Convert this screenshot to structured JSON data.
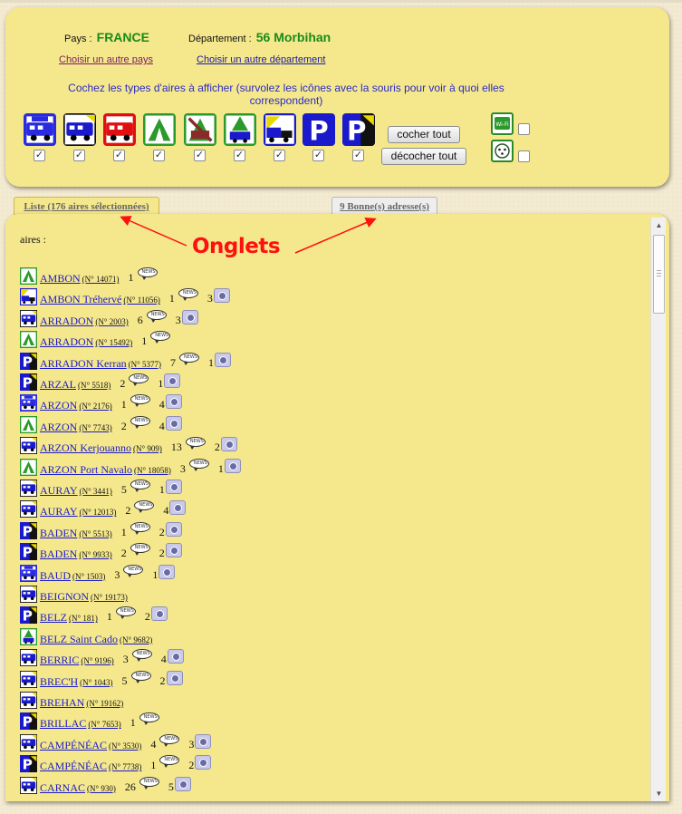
{
  "selection": {
    "country_label": "Pays :",
    "country_value": "FRANCE",
    "department_label": "Département :",
    "department_value": "56 Morbihan",
    "change_country_link": "Choisir un autre pays",
    "change_department_link": "Choisir un autre département",
    "instructions": "Cochez les types d'aires à afficher (survolez les icônes avec la souris pour voir à quoi elles correspondent)"
  },
  "type_filters": [
    {
      "icon": "motorhome-service-icon",
      "color": "#2a2ae0",
      "checked": true
    },
    {
      "icon": "motorhome-night-icon",
      "color": "#1a1acc",
      "checked": true
    },
    {
      "icon": "motorhome-paid-icon",
      "color": "#e01010",
      "checked": true
    },
    {
      "icon": "camping-icon",
      "color": "#2a9a2a",
      "checked": true
    },
    {
      "icon": "camping-closed-icon",
      "color": "#2a9a2a",
      "checked": true
    },
    {
      "icon": "camping-motorhome-icon",
      "color": "#2a9a2a",
      "checked": true
    },
    {
      "icon": "truck-night-icon",
      "color": "#1a1acc",
      "checked": true
    },
    {
      "icon": "parking-icon",
      "color": "#1a1acc",
      "checked": true
    },
    {
      "icon": "parking-night-icon",
      "color": "#1a1acc",
      "checked": true
    }
  ],
  "extra_filters": [
    {
      "icon": "wifi-icon",
      "label": "Wi-Fi",
      "checked": false
    },
    {
      "icon": "electric-plug-icon",
      "checked": false
    }
  ],
  "buttons": {
    "check_all": "cocher tout",
    "uncheck_all": "décocher tout"
  },
  "tabs": {
    "list": "Liste (176 aires sélectionnées)",
    "good_addresses": "9 Bonne(s) adresse(s)"
  },
  "annotation": "Onglets",
  "list": {
    "header": "aires :",
    "bubble_text": "NEWS",
    "rows": [
      {
        "icon": "camping-icon",
        "name": "AMBON",
        "num": "(N° 14071)",
        "comments": "1",
        "photos": ""
      },
      {
        "icon": "truck-night-icon",
        "name": "AMBON Tréhervé",
        "num": "(N° 11056)",
        "comments": "1",
        "photos": "3"
      },
      {
        "icon": "motorhome-night-icon",
        "name": "ARRADON",
        "num": "(N° 2003)",
        "comments": "6",
        "photos": "3"
      },
      {
        "icon": "camping-icon",
        "name": "ARRADON",
        "num": "(N° 15492)",
        "comments": "1",
        "photos": ""
      },
      {
        "icon": "parking-night-icon",
        "name": "ARRADON Kerran",
        "num": "(N° 5377)",
        "comments": "7",
        "photos": "1"
      },
      {
        "icon": "parking-night-icon",
        "name": "ARZAL",
        "num": "(N° 5518)",
        "comments": "2",
        "photos": "1"
      },
      {
        "icon": "motorhome-service-icon",
        "name": "ARZON",
        "num": "(N° 2176)",
        "comments": "1",
        "photos": "4"
      },
      {
        "icon": "camping-icon",
        "name": "ARZON",
        "num": "(N° 7743)",
        "comments": "2",
        "photos": "4"
      },
      {
        "icon": "motorhome-night-icon",
        "name": "ARZON Kerjouanno",
        "num": "(N° 909)",
        "comments": "13",
        "photos": "2"
      },
      {
        "icon": "camping-icon",
        "name": "ARZON Port Navalo",
        "num": "(N° 18058)",
        "comments": "3",
        "photos": "1"
      },
      {
        "icon": "motorhome-night-icon",
        "name": "AURAY",
        "num": "(N° 3441)",
        "comments": "5",
        "photos": "1"
      },
      {
        "icon": "motorhome-night-icon",
        "name": "AURAY",
        "num": "(N° 12013)",
        "comments": "2",
        "photos": "4"
      },
      {
        "icon": "parking-night-icon",
        "name": "BADEN",
        "num": "(N° 5513)",
        "comments": "1",
        "photos": "2"
      },
      {
        "icon": "parking-night-icon",
        "name": "BADEN",
        "num": "(N° 9933)",
        "comments": "2",
        "photos": "2"
      },
      {
        "icon": "motorhome-service-icon",
        "name": "BAUD",
        "num": "(N° 1503)",
        "comments": "3",
        "photos": "1"
      },
      {
        "icon": "motorhome-night-icon",
        "name": "BEIGNON",
        "num": "(N° 19173)",
        "comments": "",
        "photos": ""
      },
      {
        "icon": "parking-night-icon",
        "name": "BELZ",
        "num": "(N° 181)",
        "comments": "1",
        "photos": "2"
      },
      {
        "icon": "camping-motorhome-icon",
        "name": "BELZ Saint Cado",
        "num": "(N° 9682)",
        "comments": "",
        "photos": ""
      },
      {
        "icon": "motorhome-night-icon",
        "name": "BERRIC",
        "num": "(N° 9196)",
        "comments": "3",
        "photos": "4"
      },
      {
        "icon": "motorhome-night-icon",
        "name": "BREC'H",
        "num": "(N° 1043)",
        "comments": "5",
        "photos": "2"
      },
      {
        "icon": "motorhome-night-icon",
        "name": "BREHAN",
        "num": "(N° 19162)",
        "comments": "",
        "photos": ""
      },
      {
        "icon": "parking-night-icon",
        "name": "BRILLAC",
        "num": "(N° 7653)",
        "comments": "1",
        "photos": ""
      },
      {
        "icon": "motorhome-night-icon",
        "name": "CAMPÉNÉAC",
        "num": "(N° 3530)",
        "comments": "4",
        "photos": "3"
      },
      {
        "icon": "parking-night-icon",
        "name": "CAMPÉNÉAC",
        "num": "(N° 7738)",
        "comments": "1",
        "photos": "2"
      },
      {
        "icon": "motorhome-night-icon",
        "name": "CARNAC",
        "num": "(N° 930)",
        "comments": "26",
        "photos": "5"
      }
    ]
  }
}
